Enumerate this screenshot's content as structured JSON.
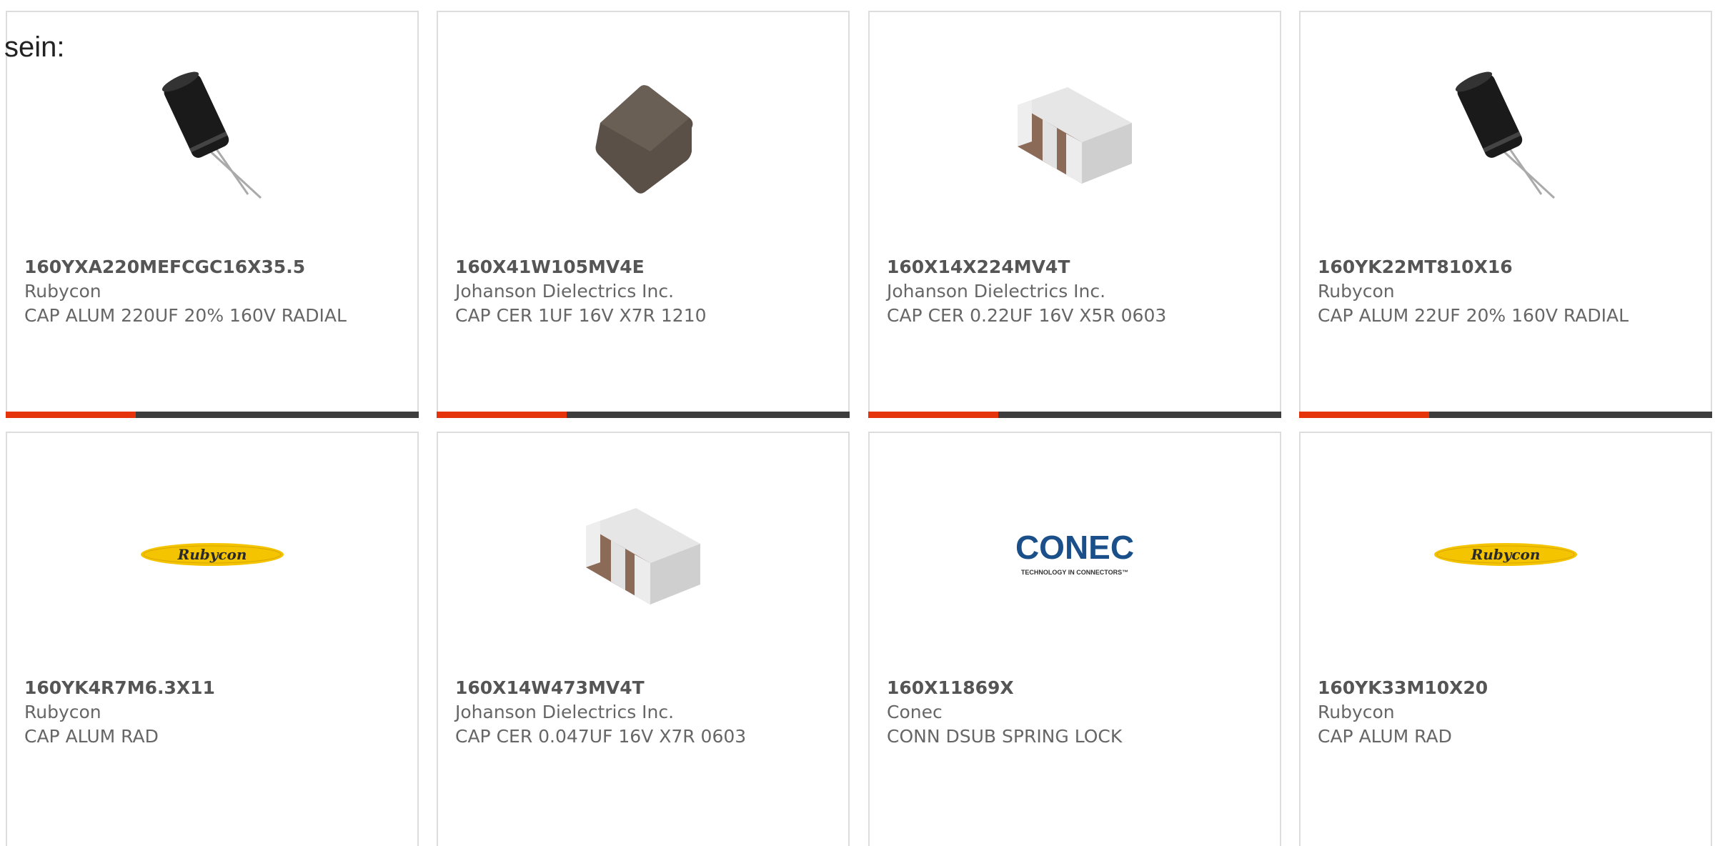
{
  "intro_text": "sein:",
  "products": [
    {
      "part_number": "160YXA220MEFCGC16X35.5",
      "manufacturer": "Rubycon",
      "description": "CAP ALUM 220UF 20% 160V RADIAL",
      "image": "radial-capacitor"
    },
    {
      "part_number": "160X41W105MV4E",
      "manufacturer": "Johanson Dielectrics Inc.",
      "description": "CAP CER 1UF 16V X7R 1210",
      "image": "ceramic-chip-capacitor"
    },
    {
      "part_number": "160X14X224MV4T",
      "manufacturer": "Johanson Dielectrics Inc.",
      "description": "CAP CER 0.22UF 16V X5R 0603",
      "image": "array-chip-capacitor"
    },
    {
      "part_number": "160YK22MT810X16",
      "manufacturer": "Rubycon",
      "description": "CAP ALUM 22UF 20% 160V RADIAL",
      "image": "radial-capacitor"
    },
    {
      "part_number": "160YK4R7M6.3X11",
      "manufacturer": "Rubycon",
      "description": "CAP ALUM RAD",
      "image": "rubycon-logo"
    },
    {
      "part_number": "160X14W473MV4T",
      "manufacturer": "Johanson Dielectrics Inc.",
      "description": "CAP CER 0.047UF 16V X7R 0603",
      "image": "array-chip-capacitor"
    },
    {
      "part_number": "160X11869X",
      "manufacturer": "Conec",
      "description": "CONN DSUB SPRING LOCK",
      "image": "conec-logo"
    },
    {
      "part_number": "160YK33M10X20",
      "manufacturer": "Rubycon",
      "description": "CAP ALUM RAD",
      "image": "rubycon-logo"
    }
  ],
  "logos": {
    "rubycon": "Rubycon",
    "conec": "CONEC",
    "conec_tagline": "TECHNOLOGY IN CONNECTORS™"
  },
  "colors": {
    "accent": "#e5340c",
    "bar": "#3d3d3d",
    "border": "#dddddd",
    "text": "#555555"
  }
}
